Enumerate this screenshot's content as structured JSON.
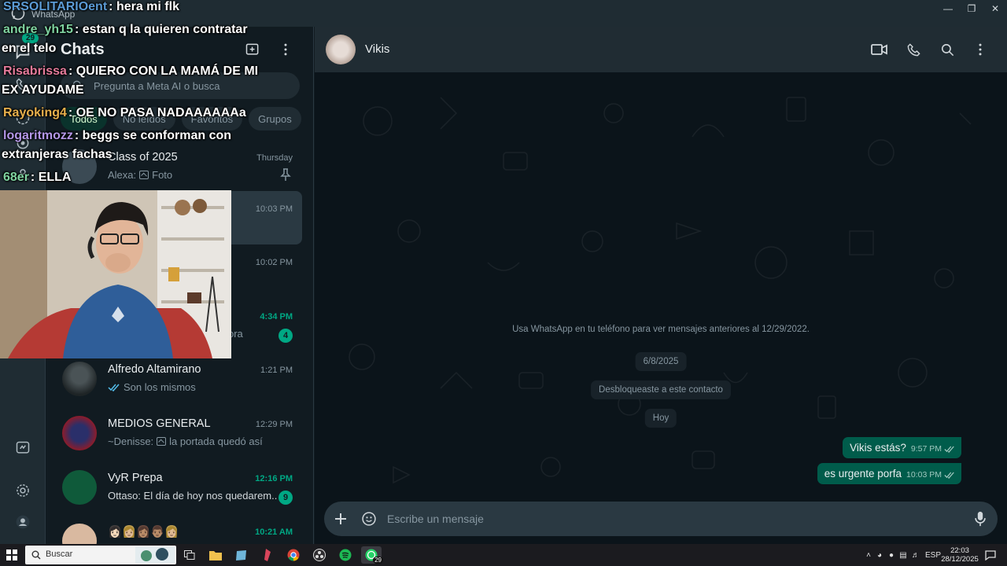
{
  "window": {
    "app_name": "WhatsApp"
  },
  "rail": {
    "badge": "29"
  },
  "chat_list": {
    "title": "Chats",
    "search_placeholder": "Pregunta a Meta AI o busca",
    "filters": [
      "Todos",
      "No leídos",
      "Favoritos",
      "Grupos"
    ],
    "chats": [
      {
        "name": "Class of 2025",
        "time": "Thursday",
        "preview_sender": "Alexa:",
        "preview": "Foto",
        "has_image": true,
        "pinned": true
      },
      {
        "name": "",
        "time": "10:03 PM",
        "preview": "",
        "selected": true
      },
      {
        "name": "",
        "time": "10:02 PM",
        "preview": ""
      },
      {
        "name": "",
        "time": "4:34 PM",
        "preview": "ora",
        "unread": "4"
      },
      {
        "name": "Alfredo Altamirano",
        "time": "1:21 PM",
        "preview": "Son los mismos",
        "read_ticks": true
      },
      {
        "name": "MEDIOS GENERAL",
        "time": "12:29 PM",
        "preview_sender": "~Denisse:",
        "preview": "la portada quedó así",
        "has_image": true
      },
      {
        "name": "VyR Prepa",
        "time": "12:16 PM",
        "preview": "Ottaso: El día de hoy nos quedarem...",
        "unread": "9"
      },
      {
        "name": "👩🏻👩🏼👩🏽👨🏽👩🏼",
        "time": "10:21 AM",
        "preview": ""
      }
    ]
  },
  "conversation": {
    "contact_name": "Vikis",
    "history_notice": "Usa WhatsApp en tu teléfono para ver mensajes anteriores al 12/29/2022.",
    "date_label": "6/8/2025",
    "unblocked_notice": "Desbloqueaste a este contacto",
    "today_label": "Hoy",
    "messages": [
      {
        "text": "Vikis estás?",
        "time": "9:57 PM"
      },
      {
        "text": "es urgente porfa",
        "time": "10:03 PM"
      }
    ],
    "composer_placeholder": "Escribe un mensaje"
  },
  "stream_chat": [
    {
      "user": "SRSOLITARIOent",
      "color": "#5b9bd5",
      "text": "hera mi flk"
    },
    {
      "user": "andre_yh15",
      "color": "#7fd3a0",
      "text": "estan q la quieren contratar"
    },
    {
      "user": "",
      "color": "#ffffff",
      "text": "en el telo"
    },
    {
      "user": "Risabrissa",
      "color": "#e57b9b",
      "text": "QUIERO CON LA MAMÁ DE MI"
    },
    {
      "user": "",
      "color": "#ffffff",
      "text": "EX AYUDAME"
    },
    {
      "user": "Rayoking4",
      "color": "#e8b04c",
      "text": "OE NO PASA NADAAAAAAa"
    },
    {
      "user": "logaritmozz",
      "color": "#b497e8",
      "text": "beggs se conforman con"
    },
    {
      "user": "",
      "color": "#ffffff",
      "text": "extranjeras fachas"
    },
    {
      "user": "68er",
      "color": "#7fd3a0",
      "text": "ELLA"
    }
  ],
  "taskbar": {
    "search_label": "Buscar",
    "whatsapp_badge": "29",
    "language": "ESP",
    "time": "22:03",
    "date": "28/12/2025"
  }
}
